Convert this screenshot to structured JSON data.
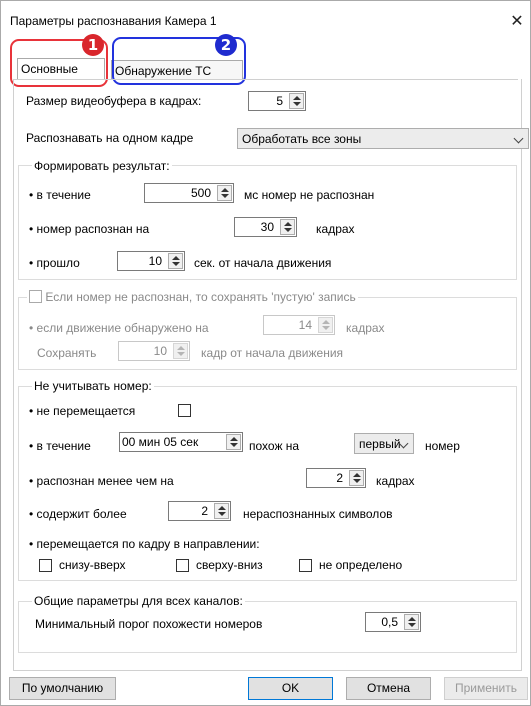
{
  "window": {
    "title": "Параметры распознавания Камера 1",
    "close_symbol": "✕"
  },
  "tabs": [
    {
      "label": "Основные"
    },
    {
      "label": "Обнаружение ТС"
    }
  ],
  "badges": [
    "1",
    "2"
  ],
  "buffer": {
    "label": "Размер видеобуфера в кадрах:",
    "value": "5"
  },
  "recognize_on_frame": {
    "label": "Распознавать на одном кадре",
    "selected": "Обработать все зоны"
  },
  "form_result": {
    "title": "Формировать результат:",
    "during": {
      "label": "• в течение",
      "value": "500",
      "suffix": "мс номер не распознан"
    },
    "recognized_on": {
      "label": "• номер распознан на",
      "value": "30",
      "suffix": "кадрах"
    },
    "passed": {
      "label": "• прошло",
      "value": "10",
      "suffix": "сек. от начала движения"
    }
  },
  "empty_record": {
    "title": "Если номер не распознан, то сохранять 'пустую' запись",
    "motion": {
      "label": "• если движение обнаружено на",
      "value": "14",
      "suffix": "кадрах"
    },
    "save": {
      "label": "Сохранять",
      "value": "10",
      "suffix": "кадр от начала движения"
    }
  },
  "ignore": {
    "title": "Не учитывать номер:",
    "not_moving": {
      "label": "• не перемещается"
    },
    "during": {
      "label": "• в течение",
      "value": "00 мин 05 сек",
      "similar": "похож на",
      "select": "первый",
      "suffix": "номер"
    },
    "recognized_less": {
      "label": "• распознан менее чем на",
      "value": "2",
      "suffix": "кадрах"
    },
    "contains_more": {
      "label": "• содержит более",
      "value": "2",
      "suffix": "нераспознанных символов"
    },
    "direction": {
      "label": "• перемещается по кадру в направлении:",
      "options": [
        "снизу-вверх",
        "сверху-вниз",
        "не определено"
      ]
    }
  },
  "common": {
    "title": "Общие параметры для всех каналов:",
    "threshold": {
      "label": "Минимальный порог похожести номеров",
      "value": "0,5"
    }
  },
  "buttons": {
    "default": "По умолчанию",
    "ok": "OK",
    "cancel": "Отмена",
    "apply": "Применить"
  },
  "colors": {
    "badge1": "#d9262c",
    "badge2": "#1f2bcf",
    "accent": "#0078d7"
  }
}
